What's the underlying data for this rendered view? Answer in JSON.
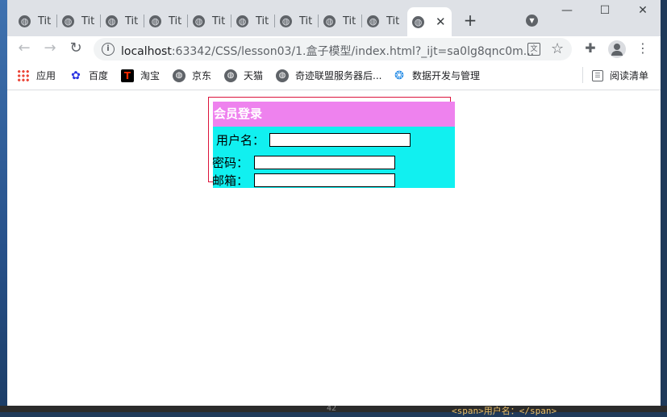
{
  "browser": {
    "tabs": [
      {
        "title": "Tit",
        "icon": "globe-icon"
      },
      {
        "title": "Tit",
        "icon": "globe-icon"
      },
      {
        "title": "Tit",
        "icon": "globe-icon"
      },
      {
        "title": "Tit",
        "icon": "globe-icon"
      },
      {
        "title": "Tit",
        "icon": "globe-icon"
      },
      {
        "title": "Tit",
        "icon": "globe-icon"
      },
      {
        "title": "Tit",
        "icon": "globe-icon"
      },
      {
        "title": "Tit",
        "icon": "globe-icon"
      },
      {
        "title": "Tit",
        "icon": "globe-icon"
      }
    ],
    "active_tab_close": "✕",
    "new_tab": "+",
    "window_controls": {
      "minimize": "—",
      "maximize": "☐",
      "close": "✕"
    },
    "url_host": "localhost",
    "url_rest": ":63342/CSS/lesson03/1.盒子模型/index.html?_ijt=sa0lg8qnc0m...",
    "bookmarks": [
      {
        "label": "应用",
        "icon": "apps-grid-icon"
      },
      {
        "label": "百度",
        "icon": "baidu-paw-icon"
      },
      {
        "label": "淘宝",
        "icon": "taobao-icon"
      },
      {
        "label": "京东",
        "icon": "globe-icon"
      },
      {
        "label": "天猫",
        "icon": "globe-icon"
      },
      {
        "label": "奇迹联盟服务器后...",
        "icon": "globe-icon"
      },
      {
        "label": "数据开发与管理",
        "icon": "dataworks-icon"
      }
    ],
    "reading_list": "阅读清单"
  },
  "page": {
    "login_title": "会员登录",
    "username_label": "用户名：",
    "username_value": "",
    "password_label": "密码：",
    "password_value": "",
    "email_label": "邮箱：",
    "email_value": "",
    "colors": {
      "border": "#dc143c",
      "header_bg": "#ee82ee",
      "body_bg": "#11f0f0"
    }
  },
  "editor_peek": {
    "line_number": "42",
    "code": "<span>用户名：</span>"
  }
}
